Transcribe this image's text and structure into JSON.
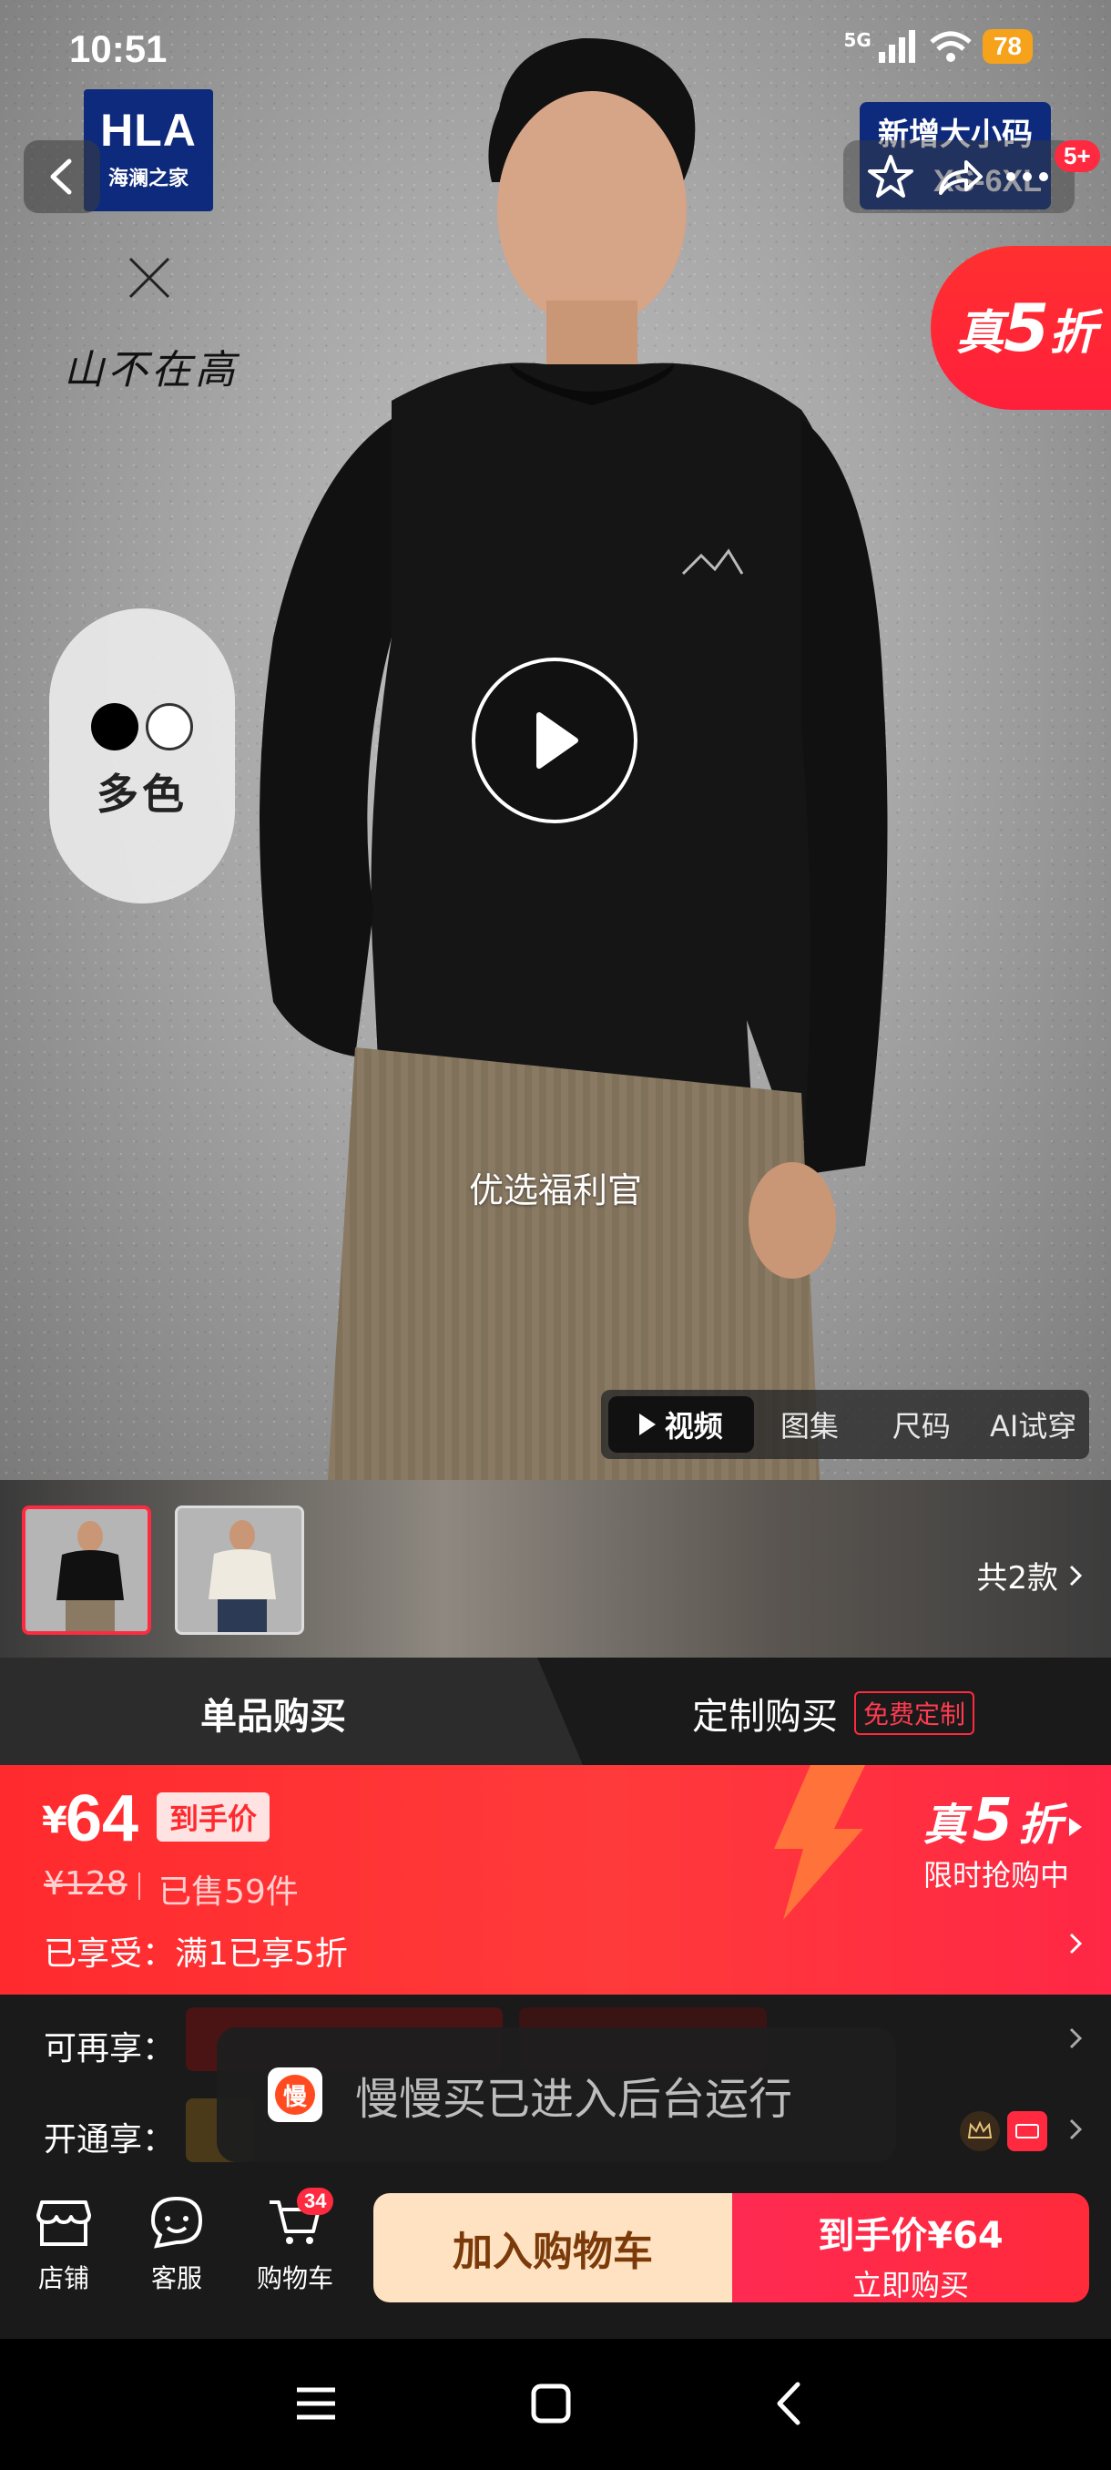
{
  "status_bar": {
    "time": "10:51",
    "network": "5G",
    "wifi_badge": "6",
    "battery": "78"
  },
  "brand": {
    "logo_text": "HLA",
    "logo_subtext": "海澜之家",
    "cobrand_text": "山不在高"
  },
  "size_banner": {
    "title": "新增大小码",
    "range": "XS-6XL"
  },
  "header": {
    "notification_count": "5+"
  },
  "discount_flag": {
    "prefix": "真",
    "number": "5",
    "suffix": "折"
  },
  "color_picker": {
    "label": "多色",
    "swatches": [
      "#000000",
      "#ffffff"
    ]
  },
  "video": {
    "caption": "优选福利官"
  },
  "media_tabs": [
    {
      "label": "视频",
      "active": true
    },
    {
      "label": "图集",
      "active": false
    },
    {
      "label": "尺码",
      "active": false
    },
    {
      "label": "AI试穿",
      "active": false
    }
  ],
  "variants": {
    "count_label": "共2款"
  },
  "buy_tabs": {
    "single": "单品购买",
    "custom": "定制购买",
    "custom_badge": "免费定制"
  },
  "price": {
    "currency": "¥",
    "final": "64",
    "final_tag": "到手价",
    "original": "¥128",
    "sold": "已售59件",
    "enjoyed": "已享受：满1已享5折",
    "flash_prefix": "真",
    "flash_number": "5",
    "flash_suffix": "折",
    "flash_sub": "限时抢购中"
  },
  "benefits": {
    "row1_label": "可再享：",
    "row2_label": "开通享："
  },
  "toast": {
    "icon_char": "慢",
    "text": "慢慢买已进入后台运行"
  },
  "bottom_nav": {
    "store": "店铺",
    "service": "客服",
    "cart": "购物车",
    "cart_count": "34"
  },
  "cta": {
    "add_to_cart": "加入购物车",
    "buy_price": "到手价¥64",
    "buy_label": "立即购买"
  },
  "colors": {
    "accent_red": "#ff2a40",
    "brand_navy": "#0e2a7d",
    "cart_button": "#ffe2c1"
  }
}
